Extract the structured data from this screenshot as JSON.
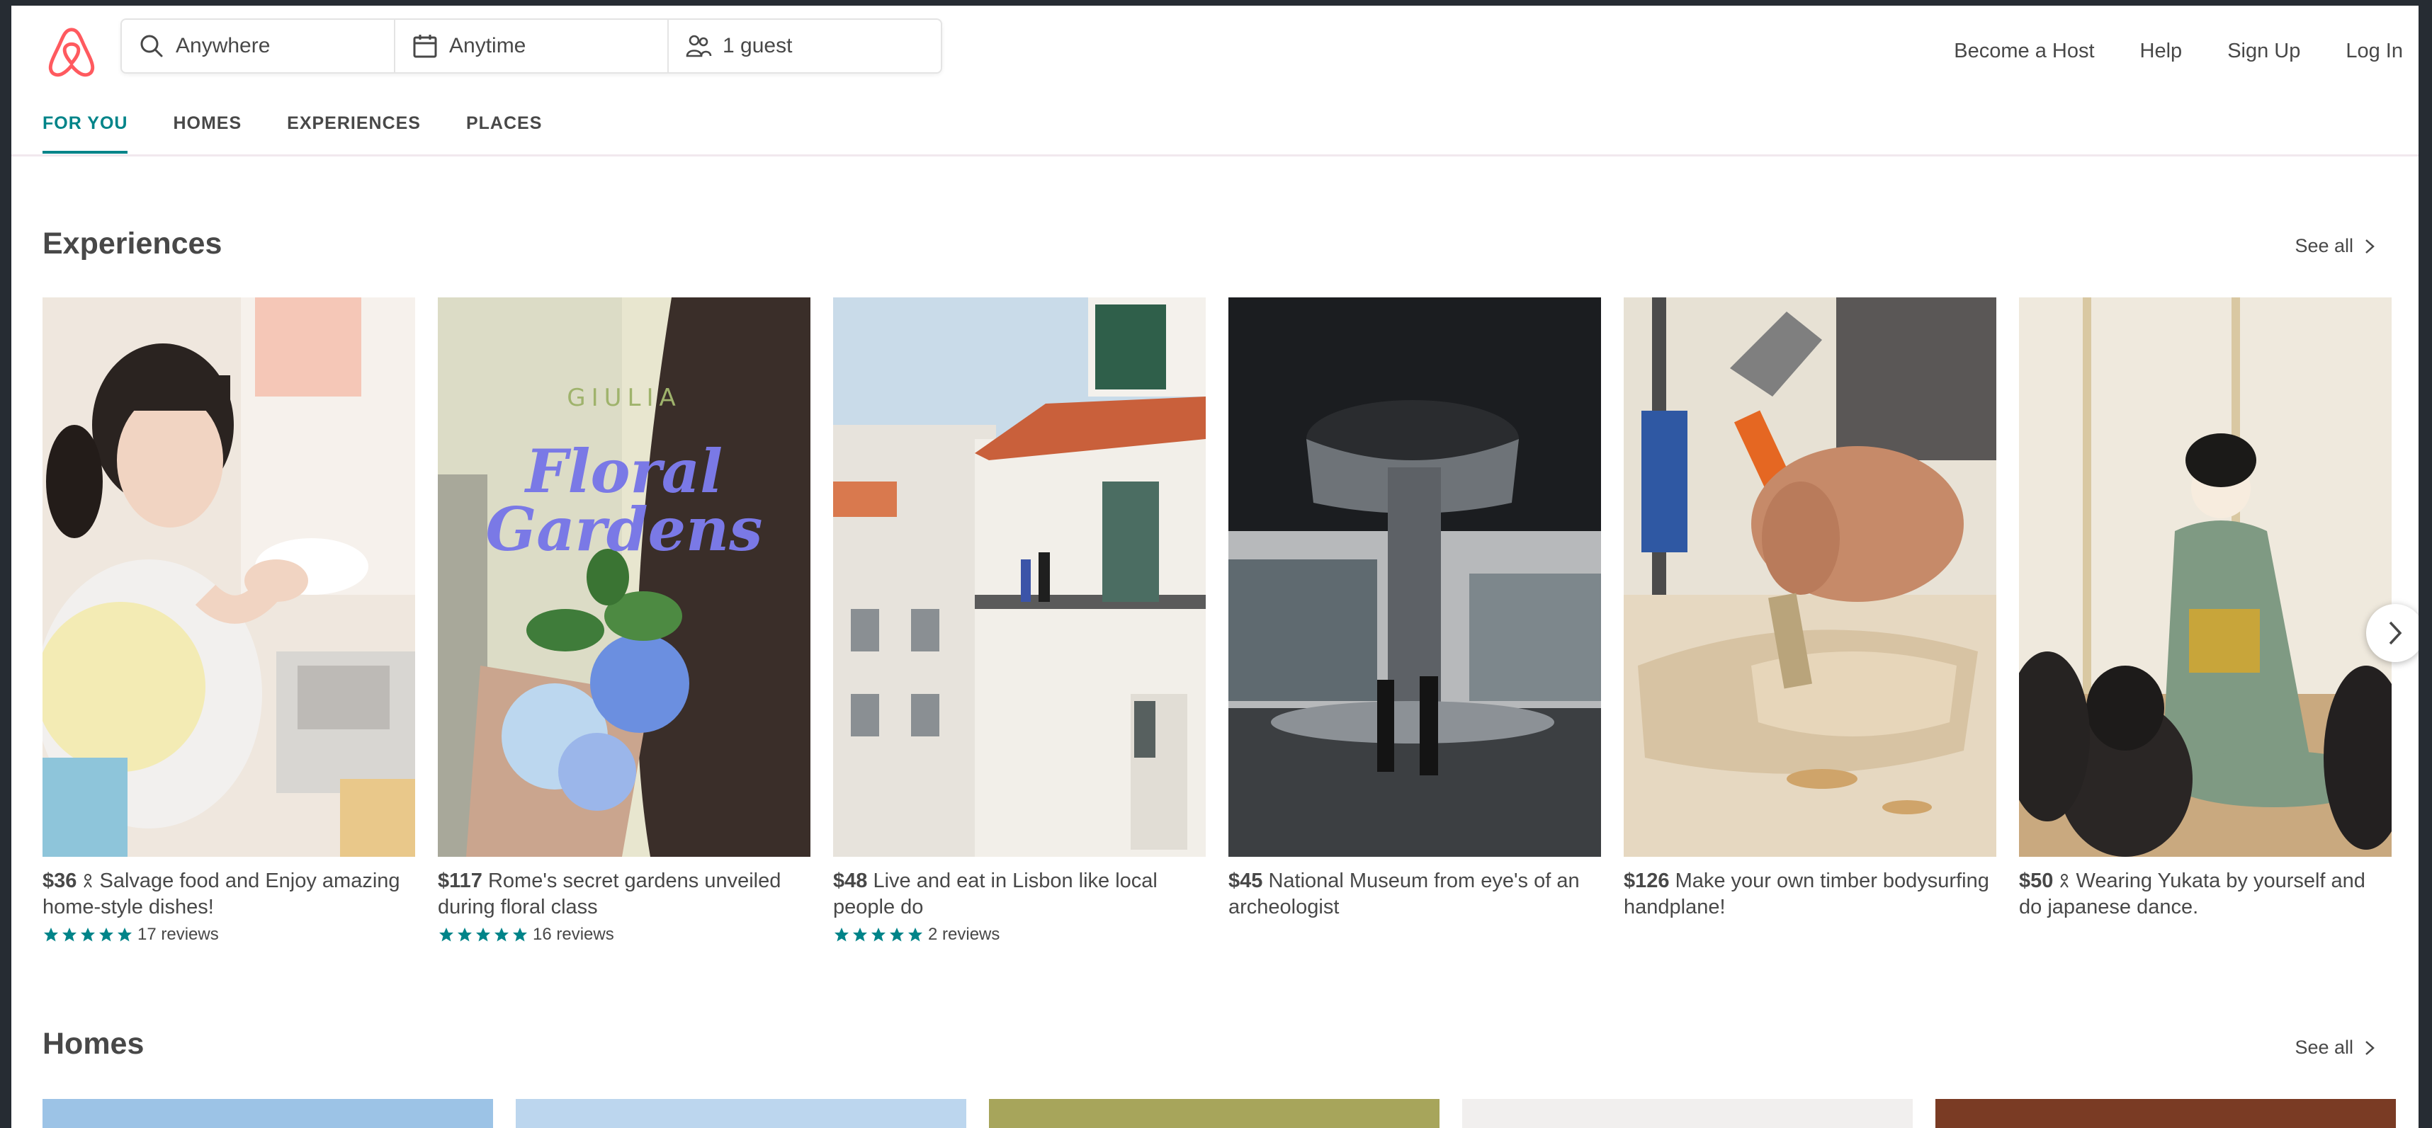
{
  "header": {
    "search": {
      "location": "Anywhere",
      "dates": "Anytime",
      "guests": "1 guest"
    },
    "links": [
      "Become a Host",
      "Help",
      "Sign Up",
      "Log In"
    ]
  },
  "tabs": [
    {
      "label": "FOR YOU",
      "active": true
    },
    {
      "label": "HOMES",
      "active": false
    },
    {
      "label": "EXPERIENCES",
      "active": false
    },
    {
      "label": "PLACES",
      "active": false
    }
  ],
  "experiences": {
    "title": "Experiences",
    "see_all": "See all",
    "cards": [
      {
        "price": "$36",
        "title": "Salvage food and Enjoy amazing home-style dishes!",
        "reviews": "17 reviews",
        "rating": 5
      },
      {
        "price": "$117",
        "title": "Rome's secret gardens unveiled during floral class",
        "reviews": "16 reviews",
        "rating": 5,
        "overlay_small": "GIULIA",
        "overlay_big_1": "Floral",
        "overlay_big_2": "Gardens"
      },
      {
        "price": "$48",
        "title": "Live and eat in Lisbon like local people do",
        "reviews": "2 reviews",
        "rating": 5
      },
      {
        "price": "$45",
        "title": "National Museum from eye's of an archeologist"
      },
      {
        "price": "$126",
        "title": "Make your own timber bodysurfing handplane!"
      },
      {
        "price": "$50",
        "title": "Wearing Yukata by yourself and do japanese dance."
      }
    ]
  },
  "homes": {
    "title": "Homes",
    "see_all": "See all"
  },
  "colors": {
    "brand": "#ff5a5f",
    "accent": "#008489",
    "text": "#484848"
  },
  "icons": {
    "logo": "airbnb-logo-icon",
    "search": "search-icon",
    "calendar": "calendar-icon",
    "guests": "guests-icon",
    "chevron": "chevron-right-icon",
    "host": "host-icon",
    "star": "star-icon"
  }
}
